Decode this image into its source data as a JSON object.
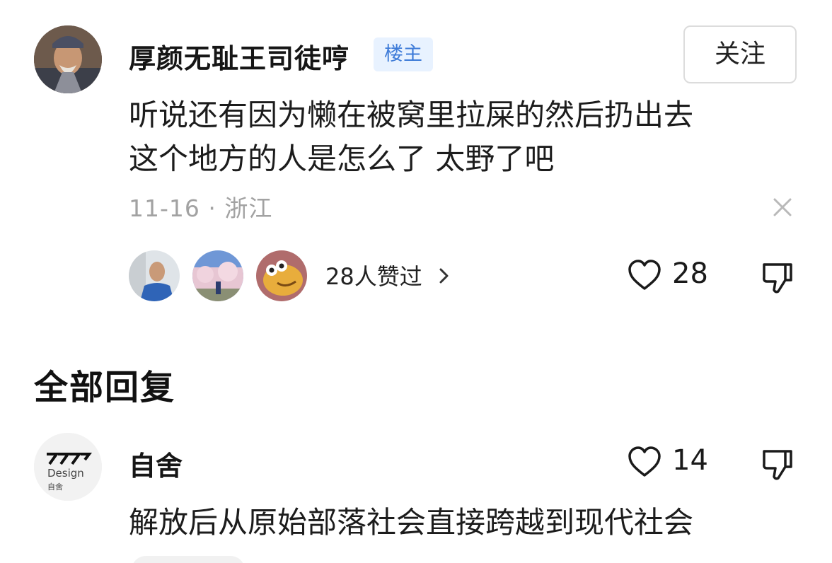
{
  "post": {
    "author": "厚颜无耻王司徒哼",
    "badge": "楼主",
    "follow_label": "关注",
    "body_line1": "听说还有因为懒在被窝里拉屎的然后扔出去",
    "body_line2": "这个地方的人是怎么了 太野了吧",
    "meta": "11-16 · 浙江",
    "likers_text": "28人赞过",
    "like_count": "28"
  },
  "replies_header": "全部回复",
  "reply": {
    "author": "自舍",
    "avatar_text": "Design",
    "avatar_subtext": "自舍",
    "like_count": "14",
    "body": "解放后从原始部落社会直接跨越到现代社会"
  },
  "icons": [
    "close-icon",
    "chevron-right-icon",
    "heart-icon",
    "thumbs-down-icon"
  ],
  "colors": {
    "badge_bg": "#e8f2ff",
    "badge_text": "#3e7bd8",
    "meta_text": "#a2a2a2"
  }
}
